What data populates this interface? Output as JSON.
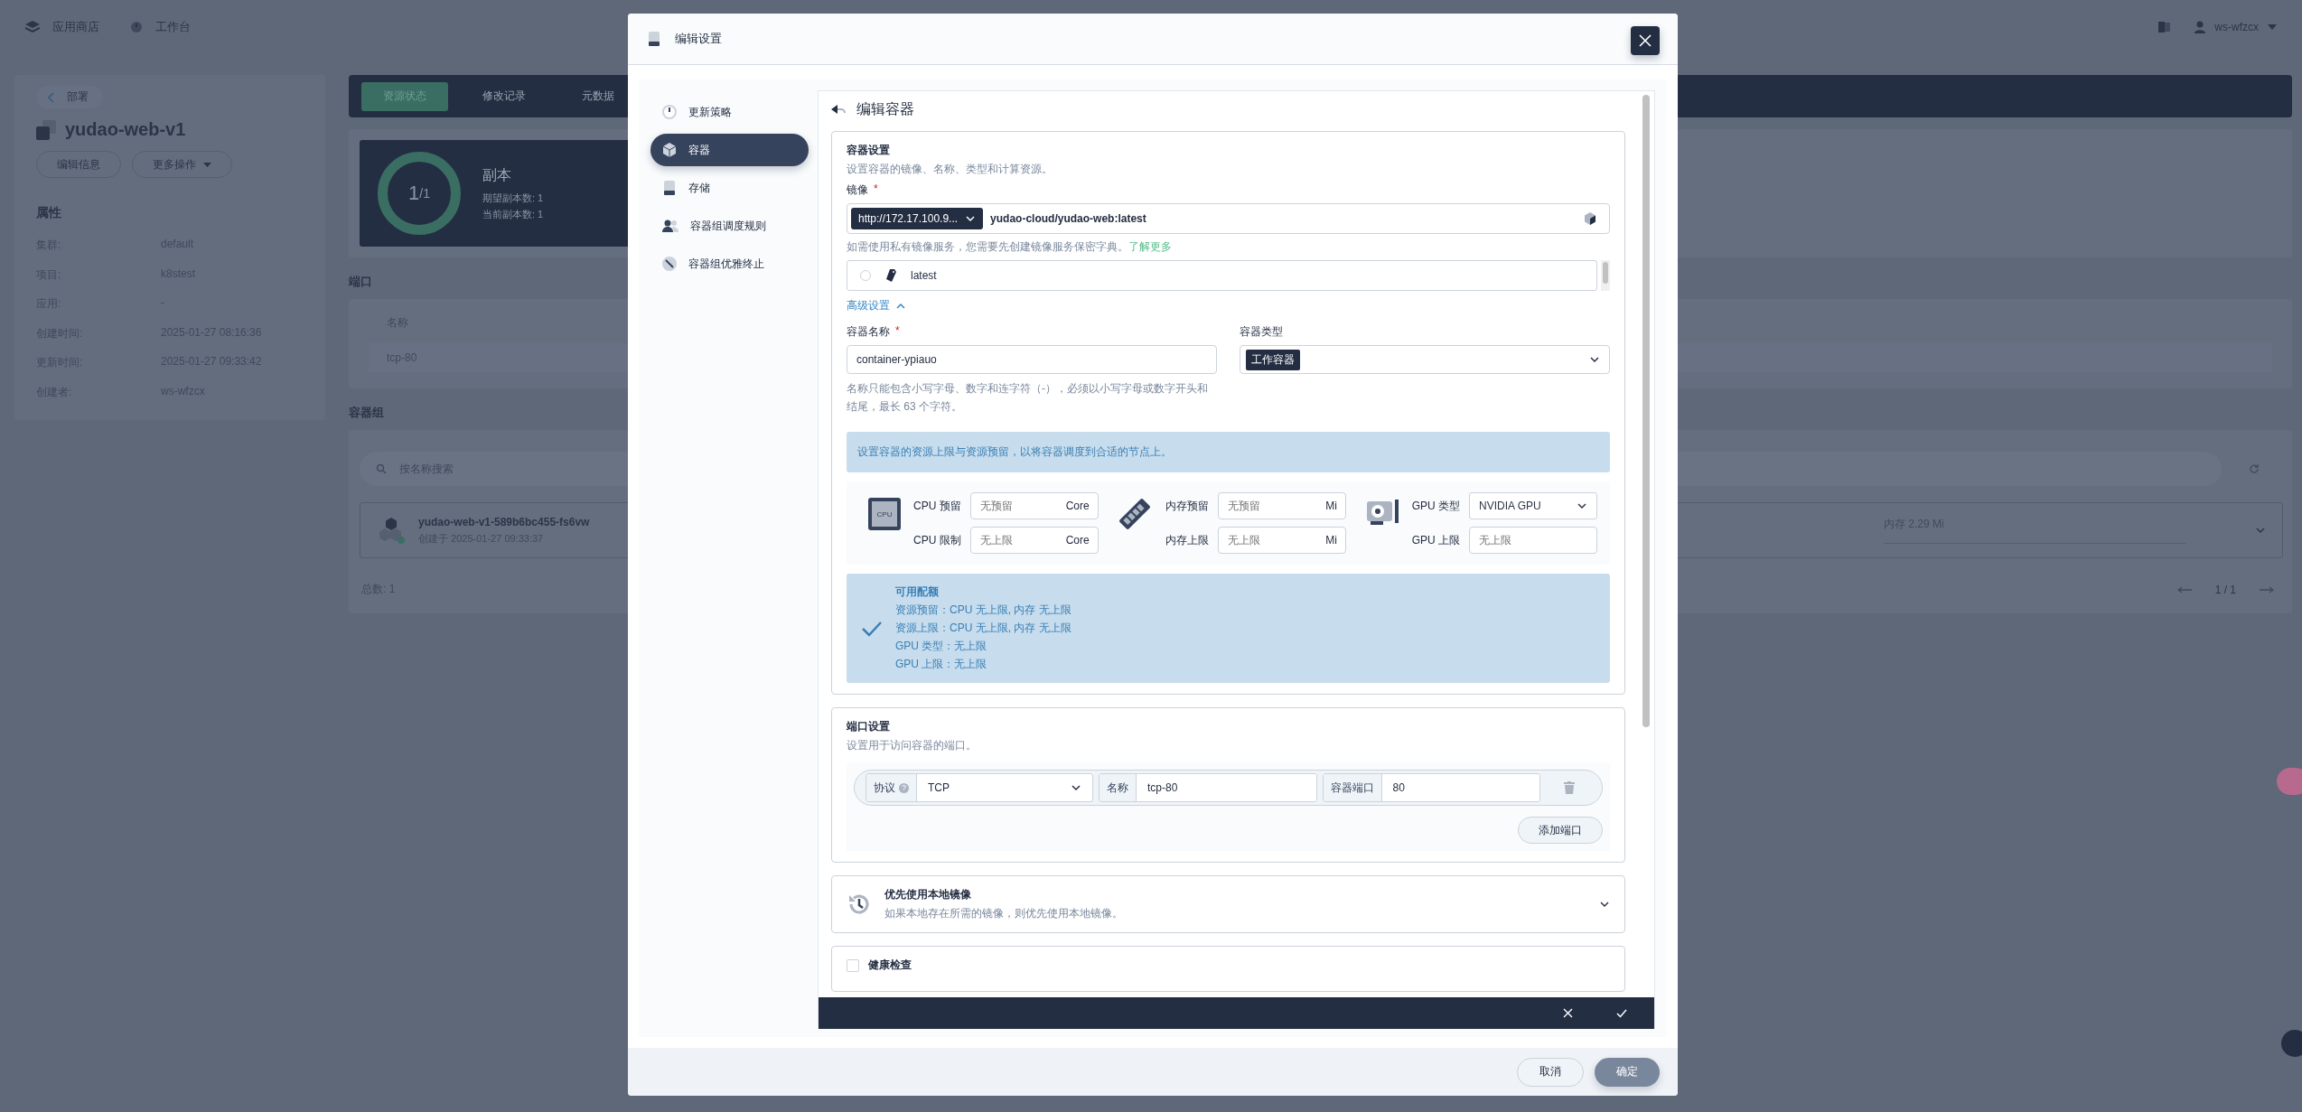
{
  "top_nav": {
    "items": [
      {
        "label": "应用商店"
      },
      {
        "label": "工作台"
      }
    ],
    "user": "ws-wfzcx"
  },
  "detail": {
    "back": "部署",
    "title": "yudao-web-v1",
    "buttons": [
      "编辑信息",
      "更多操作"
    ],
    "properties_title": "属性",
    "properties": [
      {
        "label": "集群:",
        "value": "default"
      },
      {
        "label": "项目:",
        "value": "k8stest"
      },
      {
        "label": "应用:",
        "value": "-"
      },
      {
        "label": "创建时间:",
        "value": "2025-01-27 08:16:36"
      },
      {
        "label": "更新时间:",
        "value": "2025-01-27 09:33:42"
      },
      {
        "label": "创建者:",
        "value": "ws-wfzcx"
      }
    ]
  },
  "tabs": [
    {
      "label": "资源状态",
      "selected": true
    },
    {
      "label": "修改记录",
      "selected": false
    },
    {
      "label": "元数据",
      "selected": false
    }
  ],
  "replicas": {
    "ring_value": "1",
    "ring_total": "/1",
    "title": "副本",
    "desired": "期望副本数: 1",
    "current": "当前副本数: 1"
  },
  "ports_section": {
    "title": "端口",
    "column": "名称",
    "rows": [
      "tcp-80"
    ]
  },
  "pod_section": {
    "title": "容器组",
    "search_placeholder": "按名称搜索",
    "pods": [
      {
        "name": "yudao-web-v1-589b6bc455-fs6vw",
        "created": "创建于 2025-01-27 09:33:37",
        "memory": "内存 2.29 Mi"
      }
    ],
    "total": "总数: 1",
    "page": "1 / 1"
  },
  "dialog": {
    "title": "编辑设置",
    "nav": [
      {
        "label": "更新策略",
        "selected": false
      },
      {
        "label": "容器",
        "selected": true
      },
      {
        "label": "存储",
        "selected": false
      },
      {
        "label": "容器组调度规则",
        "selected": false
      },
      {
        "label": "容器组优雅终止",
        "selected": false
      }
    ],
    "panel_title": "编辑容器",
    "container": {
      "title": "容器设置",
      "description": "设置容器的镜像、名称、类型和计算资源。",
      "image_label": "镜像",
      "image_required": "*",
      "registry": "http://172.17.100.9...",
      "image": "yudao-cloud/yudao-web:latest",
      "hint": "如需使用私有镜像服务，您需要先创建镜像服务保密字典。",
      "hint_link": "了解更多",
      "tags": [
        {
          "label": "latest",
          "selected": false
        }
      ],
      "advanced": "高级设置",
      "advanced_expanded": true,
      "name_label": "容器名称",
      "name_required": "*",
      "name_value": "container-ypiauo",
      "name_hint": "名称只能包含小写字母、数字和连字符（-），必须以小写字母或数字开头和结尾，最长 63 个字符。",
      "type_label": "容器类型",
      "type_value": "工作容器",
      "resource_info": "设置容器的资源上限与资源预留，以将容器调度到合适的节点上。",
      "resource_groups": [
        {
          "fields": [
            {
              "kind": "unit",
              "label": "CPU 预留",
              "placeholder": "无预留",
              "unit": "Core"
            },
            {
              "kind": "unit",
              "label": "CPU 限制",
              "placeholder": "无上限",
              "unit": "Core"
            }
          ]
        },
        {
          "fields": [
            {
              "kind": "unit",
              "label": "内存预留",
              "placeholder": "无预留",
              "unit": "Mi"
            },
            {
              "kind": "unit",
              "label": "内存上限",
              "placeholder": "无上限",
              "unit": "Mi"
            }
          ]
        },
        {
          "fields": [
            {
              "kind": "select",
              "label": "GPU 类型",
              "value": "NVIDIA GPU"
            },
            {
              "kind": "input",
              "label": "GPU 上限",
              "placeholder": "无上限"
            }
          ]
        }
      ],
      "cpu_chip": "CPU",
      "quota": {
        "title": "可用配额",
        "lines": [
          "资源预留：CPU 无上限, 内存 无上限",
          "资源上限：CPU 无上限, 内存 无上限",
          "GPU 类型：无上限",
          "GPU 上限：无上限"
        ]
      }
    },
    "port_settings": {
      "title": "端口设置",
      "description": "设置用于访问容器的端口。",
      "ports": [
        {
          "protocol_label": "协议",
          "protocol_help": "?",
          "protocol": "TCP",
          "name_label": "名称",
          "name": "tcp-80",
          "port_label": "容器端口",
          "port": "80"
        }
      ],
      "add": "添加端口"
    },
    "local_image": {
      "title": "优先使用本地镜像",
      "description": "如果本地存在所需的镜像，则优先使用本地镜像。",
      "expanded": false
    },
    "health_check": {
      "label": "健康检查",
      "checked": false
    },
    "cancel": "取消",
    "ok": {
      "label": "确定",
      "disabled": true
    }
  }
}
